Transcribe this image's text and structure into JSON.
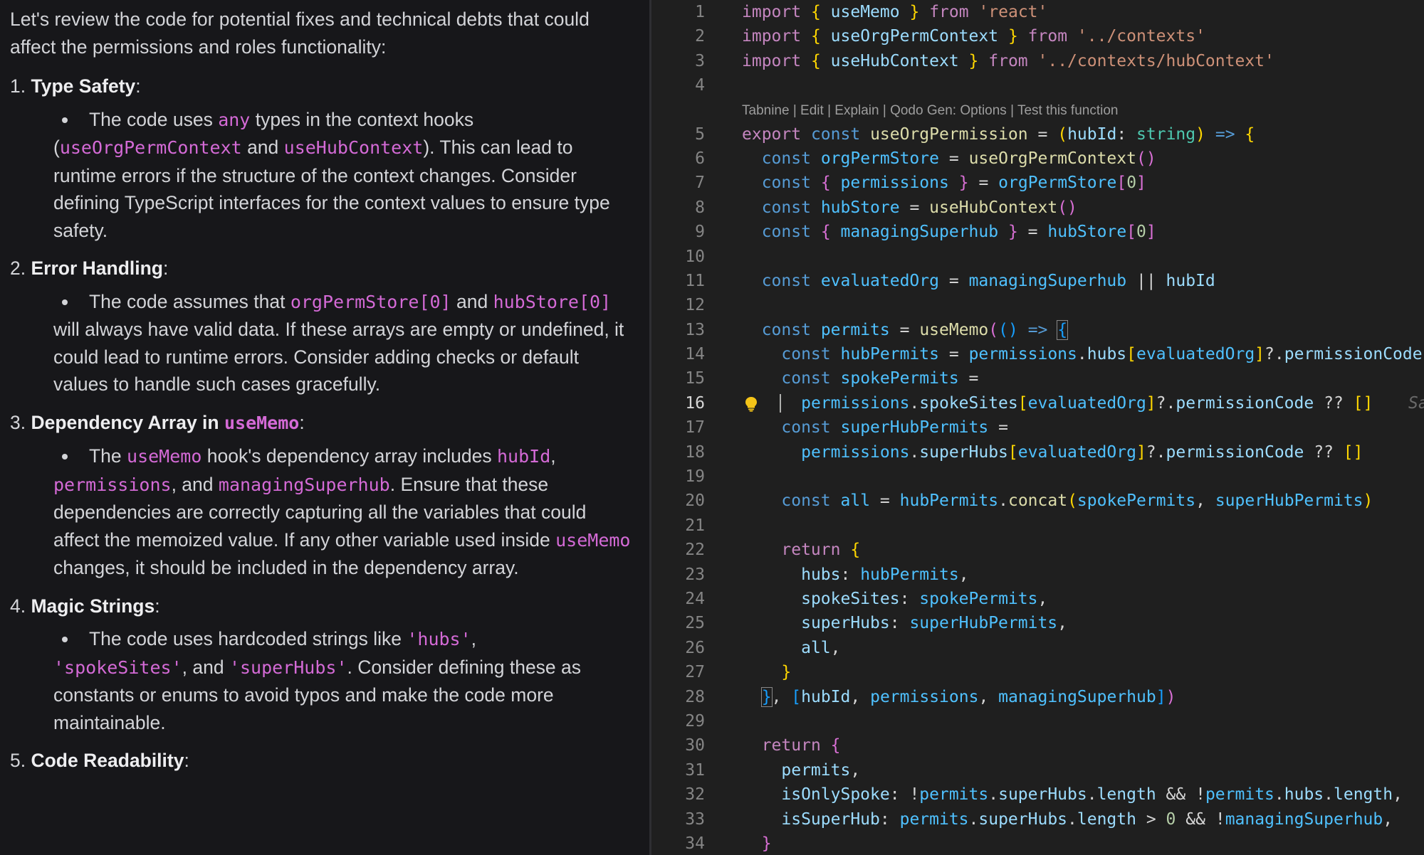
{
  "chat": {
    "intro": "Let's review the code for potential fixes and technical debts that could affect the permissions and roles functionality:",
    "sections": [
      {
        "number": "1.",
        "title": "Type Safety",
        "suffix": ":",
        "bullet": {
          "t1": "The code uses ",
          "c1": "any",
          "t2": " types in the context hooks (",
          "c2": "useOrgPermContext",
          "t3": " and ",
          "c3": "useHubContext",
          "t4": "). This can lead to runtime errors if the structure of the context changes. Consider defining TypeScript interfaces for the context values to ensure type safety."
        }
      },
      {
        "number": "2.",
        "title": "Error Handling",
        "suffix": ":",
        "bullet": {
          "t1": "The code assumes that ",
          "c1": "orgPermStore[0]",
          "t2": " and ",
          "c2": "hubStore[0]",
          "t3": " will always have valid data. If these arrays are empty or undefined, it could lead to runtime errors. Consider adding checks or default values to handle such cases gracefully."
        }
      },
      {
        "number": "3.",
        "title": "Dependency Array in ",
        "title_code": "useMemo",
        "suffix": ":",
        "bullet": {
          "t1": "The ",
          "c1": "useMemo",
          "t2": " hook's dependency array includes ",
          "c2": "hubId",
          "t3": ", ",
          "c3": "permissions",
          "t4": ", and ",
          "c4": "managingSuperhub",
          "t5": ". Ensure that these dependencies are correctly capturing all the variables that could affect the memoized value. If any other variable used inside ",
          "c5": "useMemo",
          "t6": " changes, it should be included in the dependency array."
        }
      },
      {
        "number": "4.",
        "title": "Magic Strings",
        "suffix": ":",
        "bullet": {
          "t1": "The code uses hardcoded strings like ",
          "c1": "'hubs'",
          "t2": ",",
          "c2": "'spokeSites'",
          "t3": ", and ",
          "c3": "'superHubs'",
          "t4": ". Consider defining these as constants or enums to avoid typos and make the code more maintainable."
        }
      },
      {
        "number": "5.",
        "title": "Code Readability",
        "suffix": ":"
      }
    ]
  },
  "editor": {
    "active_line": 16,
    "codelens": "Tabnine | Edit | Explain | Qodo Gen: Options | Test this function",
    "ghost_text": "Sa",
    "lightbulb_icon": "lightbulb-icon",
    "line_numbers": [
      "1",
      "2",
      "3",
      "4",
      "5",
      "6",
      "7",
      "8",
      "9",
      "10",
      "11",
      "12",
      "13",
      "14",
      "15",
      "16",
      "17",
      "18",
      "19",
      "20",
      "21",
      "22",
      "23",
      "24",
      "25",
      "26",
      "27",
      "28",
      "29",
      "30",
      "31",
      "32",
      "33",
      "34"
    ],
    "tokens": {
      "import": "import",
      "from": "from",
      "export": "export",
      "const": "const",
      "return": "return",
      "useMemo": "useMemo",
      "useOrgPermContext": "useOrgPermContext",
      "useHubContext": "useHubContext",
      "str_react": "'react'",
      "str_contexts": "'../contexts'",
      "str_hubcontext": "'../contexts/hubContext'",
      "useOrgPermission": "useOrgPermission",
      "hubId": "hubId",
      "string": "string",
      "arrow": "=>",
      "orgPermStore": "orgPermStore",
      "permissions": "permissions",
      "hubStore": "hubStore",
      "managingSuperhub": "managingSuperhub",
      "zero": "0",
      "evaluatedOrg": "evaluatedOrg",
      "permits": "permits",
      "hubPermits": "hubPermits",
      "spokePermits": "spokePermits",
      "superHubPermits": "superHubPermits",
      "hubs": "hubs",
      "spokeSites": "spokeSites",
      "superHubs": "superHubs",
      "permissionCode": "permissionCode",
      "all": "all",
      "concat": "concat",
      "length": "length",
      "isOnlySpoke": "isOnlySpoke",
      "isSuperHub": "isSuperHub"
    }
  },
  "colors": {
    "chat_bg": "#17171a",
    "chat_text": "#d3d4d8",
    "inline_code": "#d46ad6",
    "editor_bg": "#1f1f1f",
    "keyword": "#569cd6",
    "control_keyword": "#c586c0",
    "variable": "#9cdcfe",
    "function": "#dcdcaa",
    "string": "#ce9178",
    "type": "#4ec9b0",
    "number": "#b5cea8",
    "lightbulb": "#f5c518"
  }
}
